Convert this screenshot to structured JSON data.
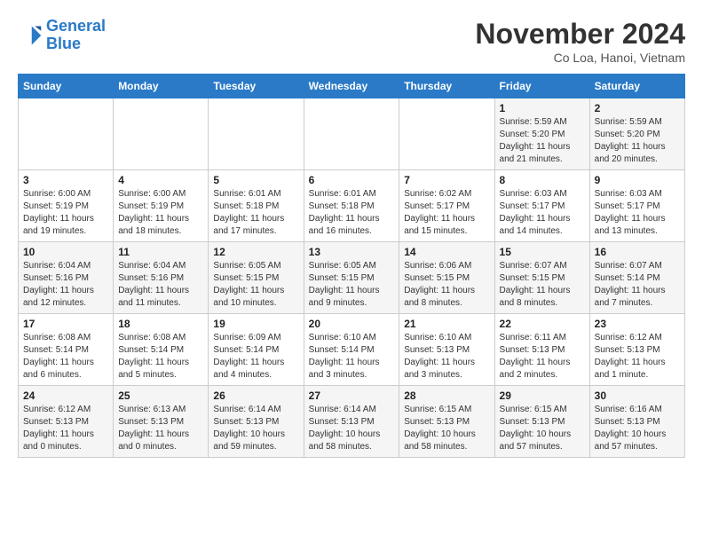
{
  "header": {
    "logo_line1": "General",
    "logo_line2": "Blue",
    "month": "November 2024",
    "location": "Co Loa, Hanoi, Vietnam"
  },
  "weekdays": [
    "Sunday",
    "Monday",
    "Tuesday",
    "Wednesday",
    "Thursday",
    "Friday",
    "Saturday"
  ],
  "weeks": [
    [
      {
        "day": "",
        "info": ""
      },
      {
        "day": "",
        "info": ""
      },
      {
        "day": "",
        "info": ""
      },
      {
        "day": "",
        "info": ""
      },
      {
        "day": "",
        "info": ""
      },
      {
        "day": "1",
        "info": "Sunrise: 5:59 AM\nSunset: 5:20 PM\nDaylight: 11 hours and 21 minutes."
      },
      {
        "day": "2",
        "info": "Sunrise: 5:59 AM\nSunset: 5:20 PM\nDaylight: 11 hours and 20 minutes."
      }
    ],
    [
      {
        "day": "3",
        "info": "Sunrise: 6:00 AM\nSunset: 5:19 PM\nDaylight: 11 hours and 19 minutes."
      },
      {
        "day": "4",
        "info": "Sunrise: 6:00 AM\nSunset: 5:19 PM\nDaylight: 11 hours and 18 minutes."
      },
      {
        "day": "5",
        "info": "Sunrise: 6:01 AM\nSunset: 5:18 PM\nDaylight: 11 hours and 17 minutes."
      },
      {
        "day": "6",
        "info": "Sunrise: 6:01 AM\nSunset: 5:18 PM\nDaylight: 11 hours and 16 minutes."
      },
      {
        "day": "7",
        "info": "Sunrise: 6:02 AM\nSunset: 5:17 PM\nDaylight: 11 hours and 15 minutes."
      },
      {
        "day": "8",
        "info": "Sunrise: 6:03 AM\nSunset: 5:17 PM\nDaylight: 11 hours and 14 minutes."
      },
      {
        "day": "9",
        "info": "Sunrise: 6:03 AM\nSunset: 5:17 PM\nDaylight: 11 hours and 13 minutes."
      }
    ],
    [
      {
        "day": "10",
        "info": "Sunrise: 6:04 AM\nSunset: 5:16 PM\nDaylight: 11 hours and 12 minutes."
      },
      {
        "day": "11",
        "info": "Sunrise: 6:04 AM\nSunset: 5:16 PM\nDaylight: 11 hours and 11 minutes."
      },
      {
        "day": "12",
        "info": "Sunrise: 6:05 AM\nSunset: 5:15 PM\nDaylight: 11 hours and 10 minutes."
      },
      {
        "day": "13",
        "info": "Sunrise: 6:05 AM\nSunset: 5:15 PM\nDaylight: 11 hours and 9 minutes."
      },
      {
        "day": "14",
        "info": "Sunrise: 6:06 AM\nSunset: 5:15 PM\nDaylight: 11 hours and 8 minutes."
      },
      {
        "day": "15",
        "info": "Sunrise: 6:07 AM\nSunset: 5:15 PM\nDaylight: 11 hours and 8 minutes."
      },
      {
        "day": "16",
        "info": "Sunrise: 6:07 AM\nSunset: 5:14 PM\nDaylight: 11 hours and 7 minutes."
      }
    ],
    [
      {
        "day": "17",
        "info": "Sunrise: 6:08 AM\nSunset: 5:14 PM\nDaylight: 11 hours and 6 minutes."
      },
      {
        "day": "18",
        "info": "Sunrise: 6:08 AM\nSunset: 5:14 PM\nDaylight: 11 hours and 5 minutes."
      },
      {
        "day": "19",
        "info": "Sunrise: 6:09 AM\nSunset: 5:14 PM\nDaylight: 11 hours and 4 minutes."
      },
      {
        "day": "20",
        "info": "Sunrise: 6:10 AM\nSunset: 5:14 PM\nDaylight: 11 hours and 3 minutes."
      },
      {
        "day": "21",
        "info": "Sunrise: 6:10 AM\nSunset: 5:13 PM\nDaylight: 11 hours and 3 minutes."
      },
      {
        "day": "22",
        "info": "Sunrise: 6:11 AM\nSunset: 5:13 PM\nDaylight: 11 hours and 2 minutes."
      },
      {
        "day": "23",
        "info": "Sunrise: 6:12 AM\nSunset: 5:13 PM\nDaylight: 11 hours and 1 minute."
      }
    ],
    [
      {
        "day": "24",
        "info": "Sunrise: 6:12 AM\nSunset: 5:13 PM\nDaylight: 11 hours and 0 minutes."
      },
      {
        "day": "25",
        "info": "Sunrise: 6:13 AM\nSunset: 5:13 PM\nDaylight: 11 hours and 0 minutes."
      },
      {
        "day": "26",
        "info": "Sunrise: 6:14 AM\nSunset: 5:13 PM\nDaylight: 10 hours and 59 minutes."
      },
      {
        "day": "27",
        "info": "Sunrise: 6:14 AM\nSunset: 5:13 PM\nDaylight: 10 hours and 58 minutes."
      },
      {
        "day": "28",
        "info": "Sunrise: 6:15 AM\nSunset: 5:13 PM\nDaylight: 10 hours and 58 minutes."
      },
      {
        "day": "29",
        "info": "Sunrise: 6:15 AM\nSunset: 5:13 PM\nDaylight: 10 hours and 57 minutes."
      },
      {
        "day": "30",
        "info": "Sunrise: 6:16 AM\nSunset: 5:13 PM\nDaylight: 10 hours and 57 minutes."
      }
    ]
  ]
}
